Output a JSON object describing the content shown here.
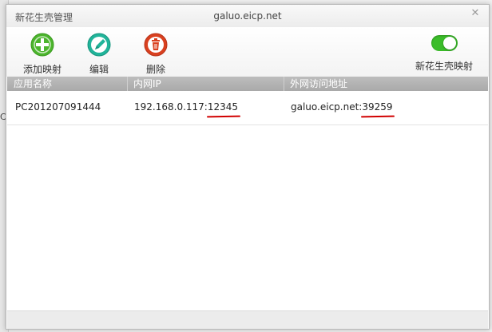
{
  "background_window": {
    "partial_text": "C"
  },
  "window": {
    "title": "新花生壳管理",
    "domain": "galuo.eicp.net",
    "close_glyph": "✕"
  },
  "toolbar": {
    "add_label": "添加映射",
    "edit_label": "编辑",
    "delete_label": "删除",
    "mapping_toggle_label": "新花生壳映射",
    "mapping_toggle_on": true
  },
  "colors": {
    "add_icon": "#4cb52d",
    "edit_icon": "#21b49a",
    "delete_icon": "#d9401f",
    "toggle_on": "#3bbd2a",
    "underline": "#d10000"
  },
  "table": {
    "columns": [
      "应用名称",
      "内网IP",
      "外网访问地址"
    ],
    "rows": [
      {
        "app_name": "PC201207091444",
        "lan_ip": "192.168.0.117:",
        "lan_port": "12345",
        "wan_host": "galuo.eicp.net:",
        "wan_port": "39259"
      }
    ]
  }
}
